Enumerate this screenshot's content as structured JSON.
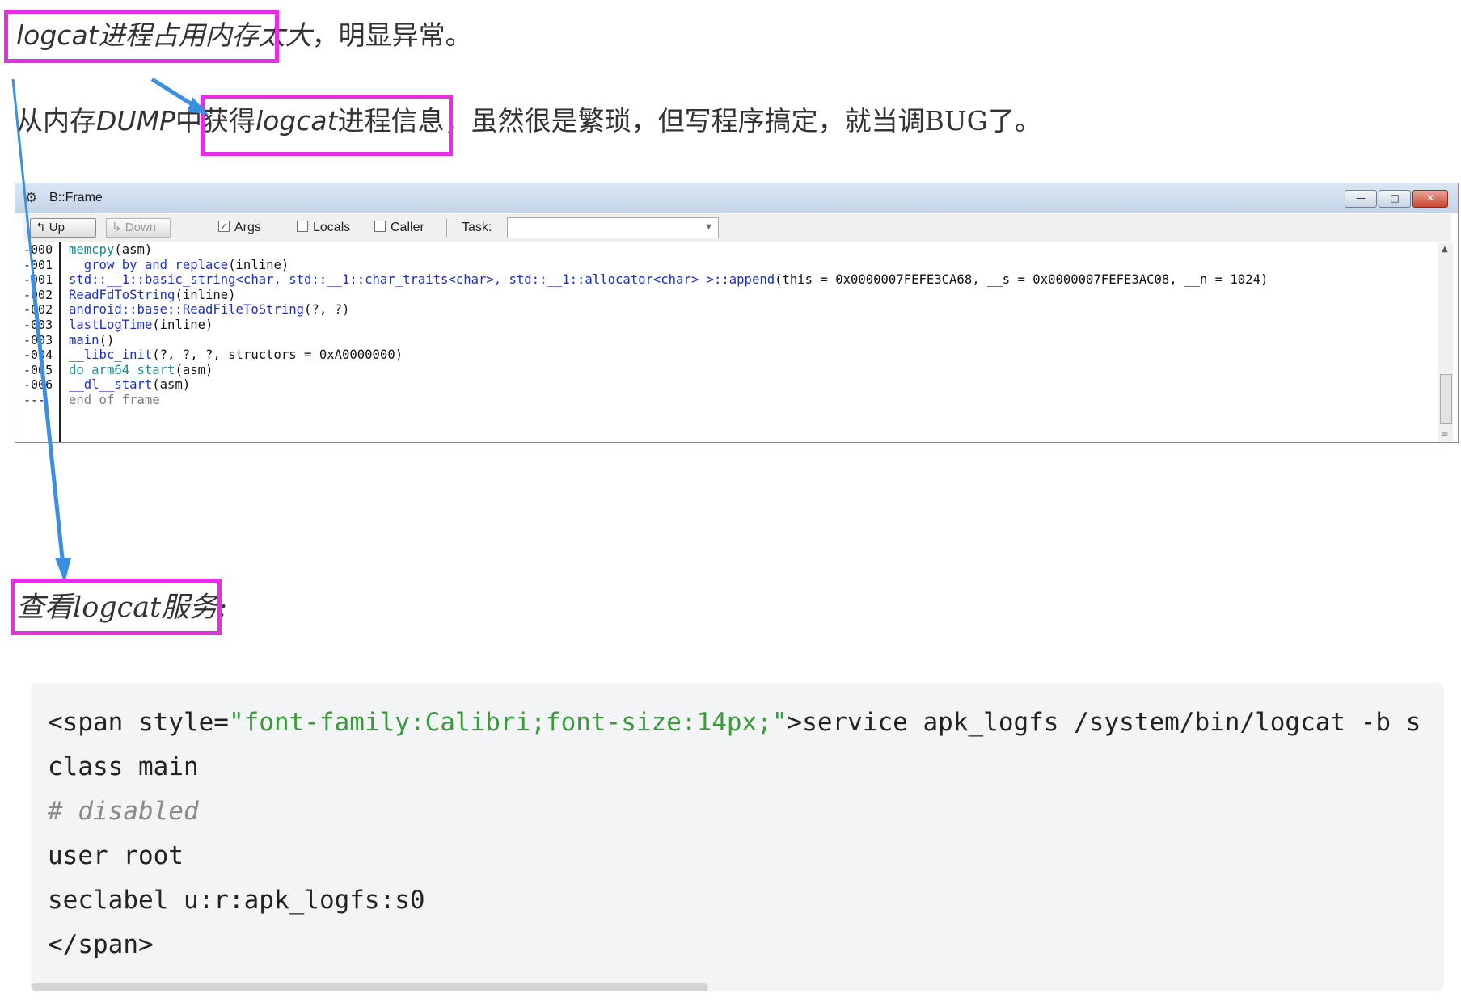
{
  "text": {
    "line1_highlight": "logcat进程占用内存太大",
    "line1_rest": "，明显异常。",
    "line2_part1_a": "从内存",
    "line2_part1_b": "DUMP",
    "line2_part1_c": "中",
    "line2_highlight_a": "获得",
    "line2_highlight_b": "logcat",
    "line2_highlight_c": "进程信息",
    "line2_rest": "，虽然很是繁琐，但写程序搞定，就当调BUG了。",
    "line3_highlight": "查看logcat服务",
    "line3_rest": ":"
  },
  "frame_window": {
    "title": "B::Frame",
    "app_icon": "debugger-icon",
    "buttons": {
      "up": "Up",
      "down": "Down",
      "args": "Args",
      "locals": "Locals",
      "caller": "Caller",
      "task": "Task:"
    },
    "args_checked": true,
    "locals_checked": false,
    "caller_checked": false,
    "task_value": "",
    "rows": [
      {
        "index": "-000",
        "func": "memcpy",
        "rest": "(asm)"
      },
      {
        "index": "-001",
        "func": "__grow_by_and_replace",
        "rest": "(inline)"
      },
      {
        "index": "-001",
        "func": "std::__1::basic_string<char, std::__1::char_traits<char>, std::__1::allocator<char> >::append",
        "rest": "(this = 0x0000007FEFE3CA68, __s = 0x0000007FEFE3AC08, __n = 1024)"
      },
      {
        "index": "-002",
        "func": "ReadFdToString",
        "rest": "(inline)"
      },
      {
        "index": "-002",
        "func": "android::base::ReadFileToString",
        "rest": "(?, ?)"
      },
      {
        "index": "-003",
        "func": "lastLogTime",
        "rest": "(inline)"
      },
      {
        "index": "-003",
        "func": "main",
        "rest": "()"
      },
      {
        "index": "-004",
        "func": "__libc_init",
        "rest": "(?, ?, ?, structors = 0xA0000000)"
      },
      {
        "index": "-005",
        "func": "do_arm64_start",
        "rest": "(asm)"
      },
      {
        "index": "-006",
        "func": "__dl__start",
        "rest": "(asm)"
      },
      {
        "index": "---",
        "func": "",
        "rest": "end of frame"
      }
    ]
  },
  "code": {
    "line1_tag_open": "<span style=",
    "line1_string": "\"font-family:Calibri;font-size:14px;\"",
    "line1_tail": ">service apk_logfs /system/bin/logcat -b s",
    "line2": "class main",
    "line3_comment": "# disabled",
    "line4": "user root",
    "line5": "seclabel u:r:apk_logfs:s0",
    "line6": "</span>"
  },
  "colors": {
    "highlight_border": "#e52ee5",
    "arrow": "#3a8fe0",
    "code_string": "#3b9a3b"
  }
}
